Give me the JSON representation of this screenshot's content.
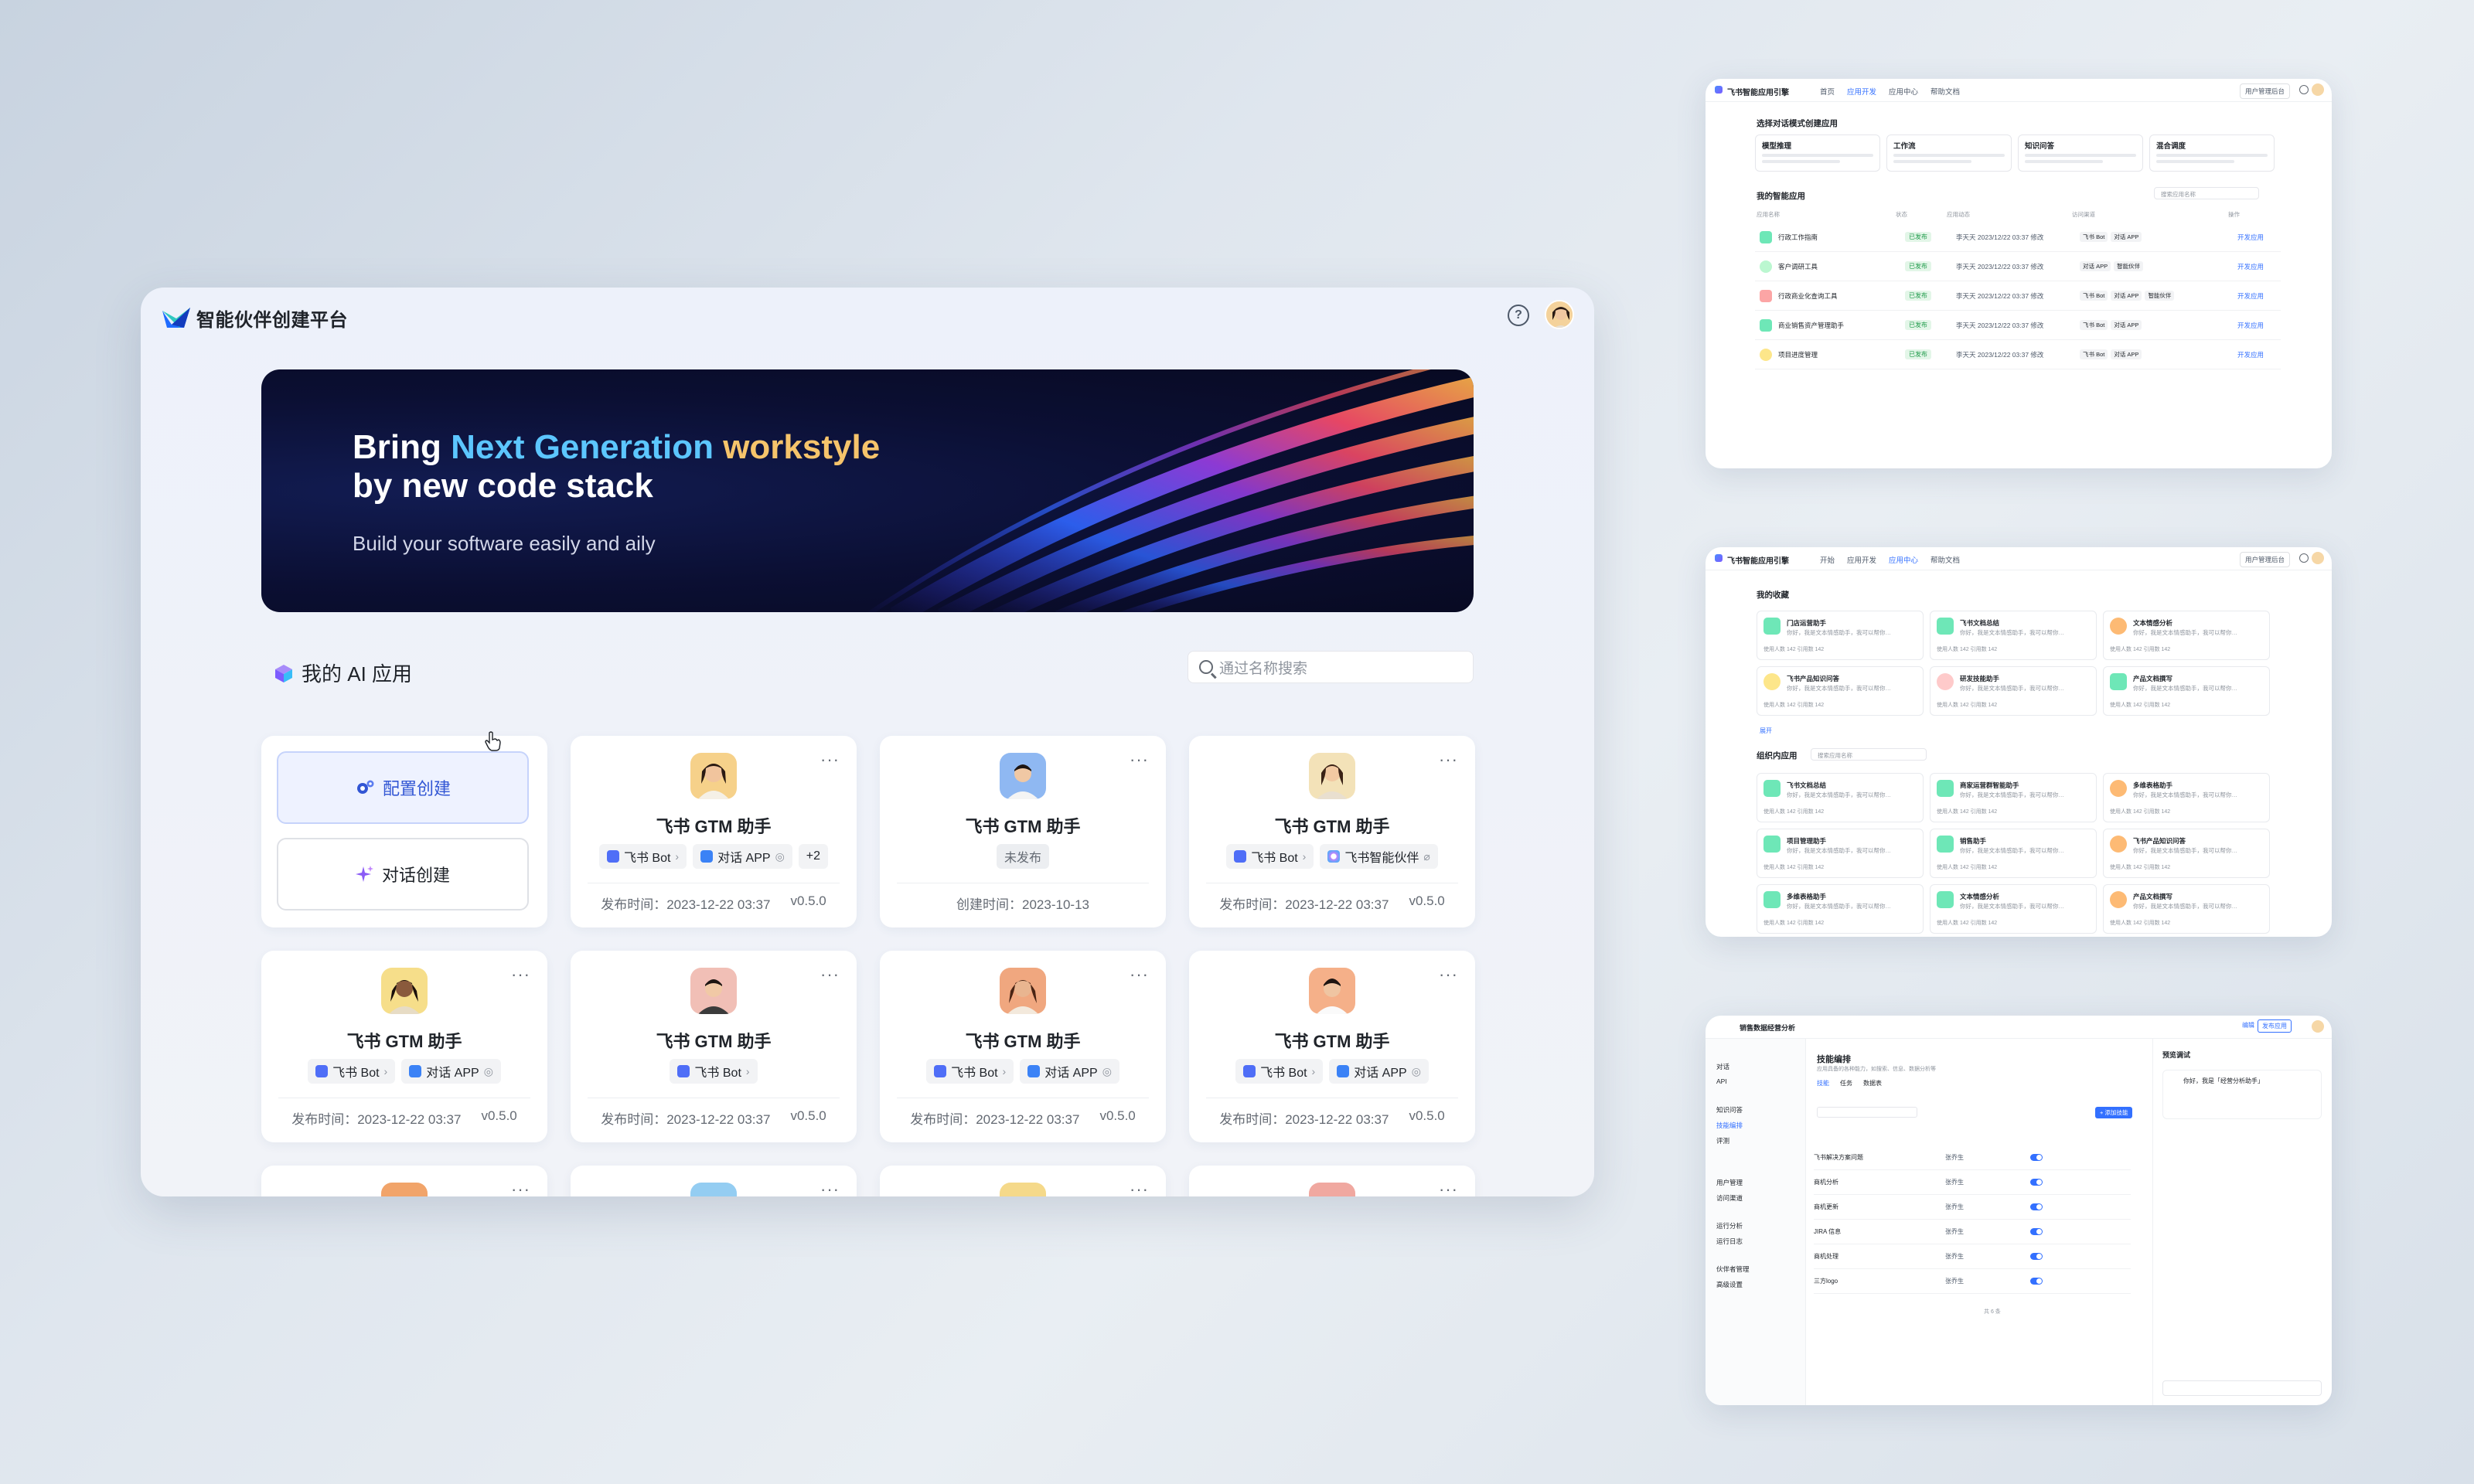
{
  "app": {
    "brand": "智能伙伴创建平台",
    "help_icon": "help-icon",
    "help_glyph": "?"
  },
  "banner": {
    "line1_a": "Bring ",
    "line1_b": "Next Generation",
    "line1_c": " workstyle",
    "line2": "by new code stack",
    "subtitle": "Build your software easily and aily"
  },
  "section": {
    "title": "我的 AI 应用",
    "search_placeholder": "通过名称搜索"
  },
  "create": {
    "config_label": "配置创建",
    "chat_label": "对话创建"
  },
  "cards": [
    {
      "name": "飞书 GTM 助手",
      "tags": [
        "飞书 Bot",
        "对话 APP",
        "+2"
      ],
      "date": "发布时间：2023-12-22 03:37",
      "version": "v0.5.0",
      "more": "···"
    },
    {
      "name": "飞书 GTM 助手",
      "status": "未发布",
      "date": "创建时间：2023-10-13",
      "more": "···"
    },
    {
      "name": "飞书 GTM 助手",
      "tags": [
        "飞书 Bot",
        "飞书智能伙伴"
      ],
      "date": "发布时间：2023-12-22 03:37",
      "version": "v0.5.0",
      "more": "···"
    },
    {
      "name": "飞书 GTM 助手",
      "tags": [
        "飞书 Bot",
        "对话 APP"
      ],
      "date": "发布时间：2023-12-22 03:37",
      "version": "v0.5.0",
      "more": "···"
    },
    {
      "name": "飞书 GTM 助手",
      "tags": [
        "飞书 Bot"
      ],
      "date": "发布时间：2023-12-22 03:37",
      "version": "v0.5.0",
      "more": "···"
    },
    {
      "name": "飞书 GTM 助手",
      "tags": [
        "飞书 Bot",
        "对话 APP"
      ],
      "date": "发布时间：2023-12-22 03:37",
      "version": "v0.5.0",
      "more": "···"
    },
    {
      "name": "飞书 GTM 助手",
      "tags": [
        "飞书 Bot",
        "对话 APP"
      ],
      "date": "发布时间：2023-12-22 03:37",
      "version": "v0.5.0",
      "more": "···"
    }
  ],
  "thumb1": {
    "brand": "飞书智能应用引擎",
    "nav": [
      "首页",
      "应用开发",
      "应用中心",
      "帮助文档"
    ],
    "manage": "用户管理后台",
    "mode_title": "选择对话模式创建应用",
    "modes": [
      "模型推理",
      "工作流",
      "知识问答",
      "混合调度"
    ],
    "list_title": "我的智能应用",
    "search": "搜索应用名称",
    "cols": [
      "应用名称",
      "状态",
      "应用动态",
      "访问渠道",
      "操作"
    ],
    "rows": [
      {
        "name": "行政工作指南",
        "status": "已发布",
        "owner": "李天天",
        "time": "2023/12/22 03:37 修改",
        "tags": [
          "飞书 Bot",
          "对话 APP"
        ],
        "op": "开发应用"
      },
      {
        "name": "客户调研工具",
        "status": "已发布",
        "owner": "李天天",
        "time": "2023/12/22 03:37 修改",
        "tags": [
          "对话 APP",
          "智能伙伴"
        ],
        "op": "开发应用"
      },
      {
        "name": "行政商业化查询工具",
        "status": "已发布",
        "owner": "李天天",
        "time": "2023/12/22 03:37 修改",
        "tags": [
          "飞书 Bot",
          "对话 APP",
          "智能伙伴"
        ],
        "op": "开发应用"
      },
      {
        "name": "商业销售资产管理助手",
        "status": "已发布",
        "owner": "李天天",
        "time": "2023/12/22 03:37 修改",
        "tags": [
          "飞书 Bot",
          "对话 APP"
        ],
        "op": "开发应用"
      },
      {
        "name": "项目进度管理",
        "status": "已发布",
        "owner": "李天天",
        "time": "2023/12/22 03:37 修改",
        "tags": [
          "飞书 Bot",
          "对话 APP"
        ],
        "op": "开发应用"
      }
    ]
  },
  "thumb2": {
    "brand": "飞书智能应用引擎",
    "nav": [
      "开始",
      "应用开发",
      "应用中心",
      "帮助文档"
    ],
    "manage": "用户管理后台",
    "fav_title": "我的收藏",
    "expand": "展开",
    "org_title": "组织内应用",
    "org_search": "搜索应用名称",
    "favs": [
      "门店运营助手",
      "飞书文档总结",
      "文本情感分析",
      "飞书产品知识问答",
      "研发技能助手",
      "产品文档撰写"
    ],
    "orgs": [
      "飞书文档总结",
      "商家运营群智能助手",
      "多维表格助手",
      "项目管理助手",
      "销售助手",
      "飞书产品知识问答",
      "多维表格助手",
      "文本情感分析",
      "产品文档撰写"
    ],
    "desc": "你好，我是文本情感助手，我可以帮你…",
    "meta": "使用人数 142   引用数 142"
  },
  "thumb3": {
    "app": "销售数据经营分析",
    "publish": "发布应用",
    "editing": "编辑",
    "side_items": [
      "对话",
      "API",
      "知识问答",
      "技能编排",
      "评测",
      "用户管理",
      "访问渠道",
      "运行分析",
      "运行日志",
      "伙伴者管理",
      "高级设置"
    ],
    "title": "技能编排",
    "desc": "应用具备的各种能力，如搜索、信息、数据分析等",
    "tabs": [
      "技能",
      "任务",
      "数据表"
    ],
    "add": "+ 添加技能",
    "skills": [
      "飞书解决方案问题",
      "商机分析",
      "商机更新",
      "JIRA 信息",
      "商机处理",
      "三方logo"
    ],
    "owner": "张乔生",
    "preview": "预览调试",
    "chat": "你好，我是「经营分析助手」",
    "pager": "共 6 条"
  }
}
